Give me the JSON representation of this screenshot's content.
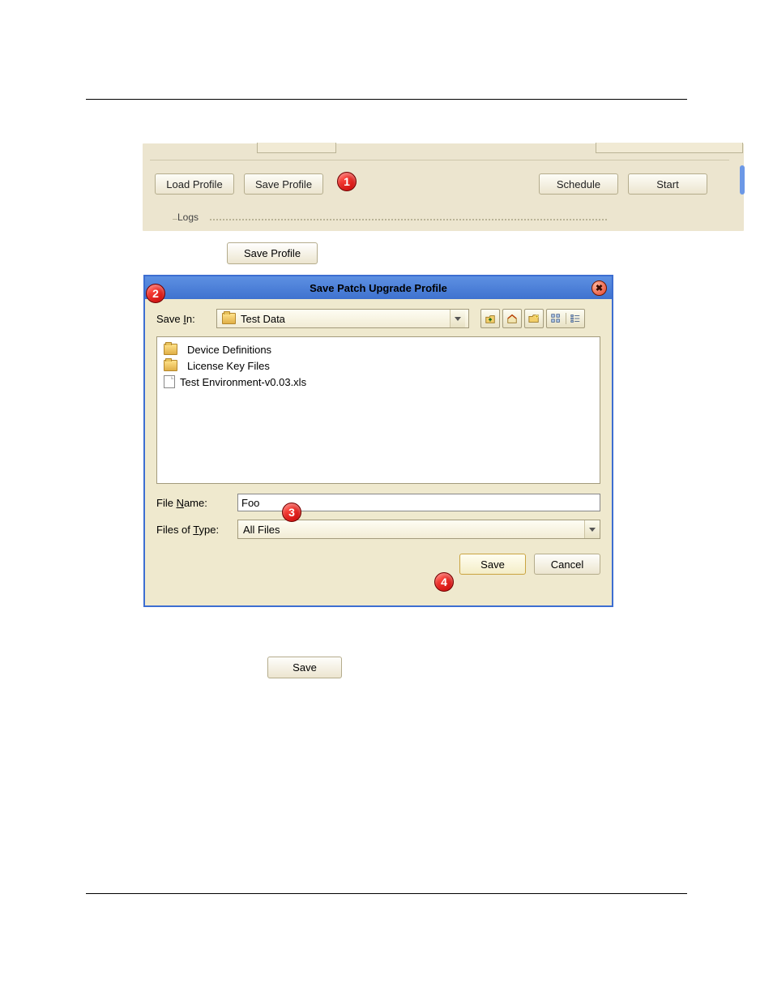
{
  "toolbar": {
    "load_profile": "Load Profile",
    "save_profile": "Save Profile",
    "schedule": "Schedule",
    "start": "Start"
  },
  "logs_label": "Logs",
  "save_profile_standalone": "Save Profile",
  "dialog": {
    "title": "Save Patch Upgrade Profile",
    "close_glyph": "✖",
    "save_in_label": "Save In:",
    "save_in_value": "Test Data",
    "files": [
      {
        "type": "folder",
        "name": "Device Definitions"
      },
      {
        "type": "folder",
        "name": "License Key Files"
      },
      {
        "type": "file",
        "name": "Test Environment-v0.03.xls"
      }
    ],
    "file_name_label": "File Name:",
    "file_name_value": "Foo",
    "file_type_label": "Files of Type:",
    "file_type_value": "All Files",
    "save_btn": "Save",
    "cancel_btn": "Cancel"
  },
  "bottom_save_btn": "Save",
  "callouts": {
    "c1": "1",
    "c2": "2",
    "c3": "3",
    "c4": "4"
  }
}
